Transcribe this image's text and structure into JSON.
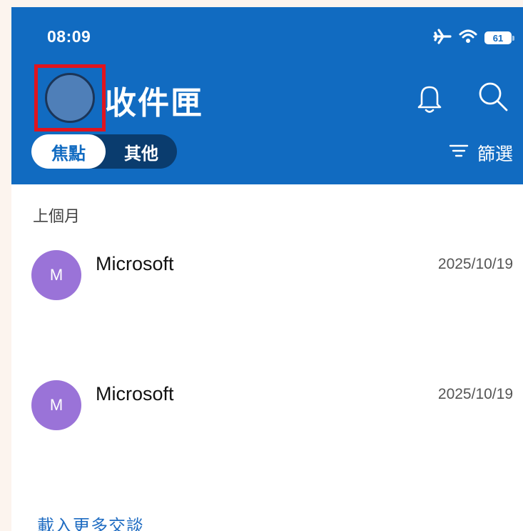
{
  "status_bar": {
    "time": "08:09",
    "battery": "61",
    "icons": [
      "airplane-icon",
      "wifi-icon",
      "battery-icon"
    ]
  },
  "header": {
    "title": "收件匣",
    "bell_icon": "bell-icon",
    "search_icon": "search-icon",
    "tabs": [
      {
        "label": "焦點",
        "active": true
      },
      {
        "label": "其他",
        "active": false
      }
    ],
    "filter_label": "篩選",
    "filter_icon": "filter-icon"
  },
  "section": {
    "label": "上個月"
  },
  "emails": [
    {
      "avatar_letter": "M",
      "sender": "Microsoft",
      "date": "2025/10/19"
    },
    {
      "avatar_letter": "M",
      "sender": "Microsoft",
      "date": "2025/10/19"
    }
  ],
  "load_more": "載入更多交談",
  "colors": {
    "header_bg": "#116bc1",
    "avatar_purple": "#9a73d8",
    "highlight_red": "#e0141e",
    "link_blue": "#1f6cc2"
  }
}
